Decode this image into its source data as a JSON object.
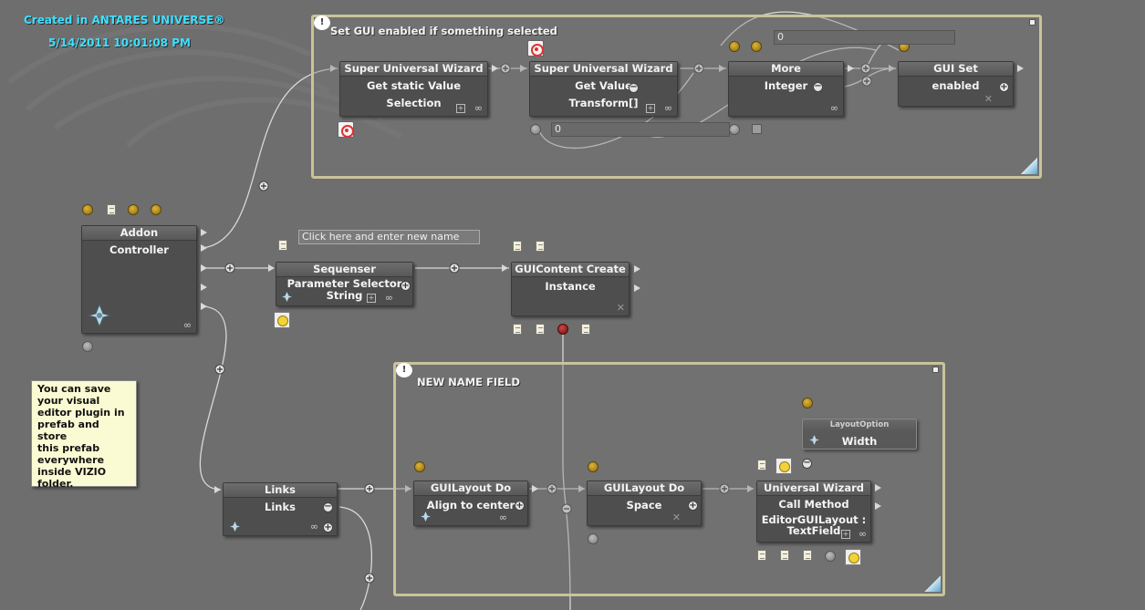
{
  "header": {
    "created_text": "Created in ANTARES UNIVERSE®",
    "timestamp": "5/14/2011 10:01:08 PM"
  },
  "groups": {
    "top": {
      "title": "Set GUI enabled if something selected"
    },
    "bottom": {
      "title": "NEW NAME FIELD"
    }
  },
  "nodes": {
    "suw1": {
      "title": "Super Universal Wizard",
      "line1": "Get static Value",
      "line2": "Selection"
    },
    "suw2": {
      "title": "Super Universal Wizard",
      "line1": "Get Value",
      "line2": "Transform[]"
    },
    "more": {
      "title": "More",
      "line1": "Integer"
    },
    "guiset": {
      "title": "GUI Set",
      "line1": "enabled"
    },
    "addon": {
      "title": "Addon",
      "line1": "Controller"
    },
    "sequenser": {
      "title": "Sequenser",
      "line1": "Parameter Selector",
      "line2": "String"
    },
    "guicontent": {
      "title": "GUIContent Create",
      "line1": "Instance"
    },
    "links": {
      "title": "Links",
      "line1": "Links"
    },
    "guilayout1": {
      "title": "GUILayout Do",
      "line1": "Align to center"
    },
    "guilayout2": {
      "title": "GUILayout Do",
      "line1": "Space"
    },
    "layoutoption": {
      "title": "LayoutOption",
      "line1": "Width"
    },
    "uw": {
      "title": "Universal Wizard",
      "line1": "Call Method",
      "line2": "EditorGUILayout :",
      "line3": "TextField"
    }
  },
  "fields": {
    "more_value": "0",
    "suw2_value": "0",
    "name_input_placeholder": "Click here and enter new name"
  },
  "note": {
    "lines": [
      "You can save",
      "your visual",
      "editor plugin in",
      "prefab and store",
      "this prefab",
      "everywhere",
      "inside VIZIO",
      "folder."
    ]
  },
  "colors": {
    "background": "#6e6e6e",
    "header_text": "#3fe0ff",
    "group_border": "#c9c39a",
    "node_body": "#4e4e4e",
    "note_bg": "#fbfbd3"
  },
  "icons": [
    "comment-icon",
    "target-icon",
    "plus-icon",
    "minus-icon",
    "link-icon",
    "document-icon",
    "bulb-icon",
    "antares-logo-icon",
    "resize-icon"
  ]
}
